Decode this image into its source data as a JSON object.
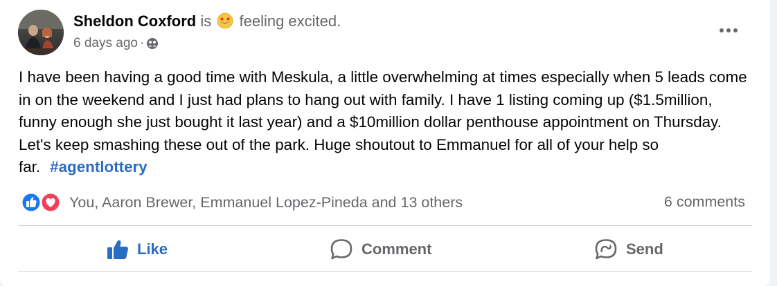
{
  "post": {
    "author": "Sheldon Coxford",
    "is_text": "is",
    "feeling_text": "feeling excited.",
    "feeling_icon": "grinning-star-eyes-emoji-icon",
    "time": "6 days ago",
    "separator": "·",
    "audience_icon": "friends-icon",
    "text": "I have been having a good time with Meskula, a little overwhelming at times especially when 5 leads come in on the weekend and I just had plans to hang out with family. I have 1 listing coming up ($1.5million, funny enough she just bought it last year) and a $10million dollar penthouse appointment on Thursday. Let's keep smashing these out of the park. Huge shoutout to Emmanuel for all of your help so far.",
    "hashtag": "#agentlottery"
  },
  "reactions": {
    "icons": [
      "like-reaction-icon",
      "love-reaction-icon"
    ],
    "summary": "You, Aaron Brewer, Emmanuel Lopez-Pineda and 13 others",
    "comments": "6 comments"
  },
  "actions": {
    "like_label": "Like",
    "comment_label": "Comment",
    "send_label": "Send"
  },
  "colors": {
    "accent": "#2a6cc4",
    "like_blue": "#1877f2",
    "love_red": "#f33e58",
    "secondary_text": "#65676b",
    "primary_text": "#050505"
  }
}
